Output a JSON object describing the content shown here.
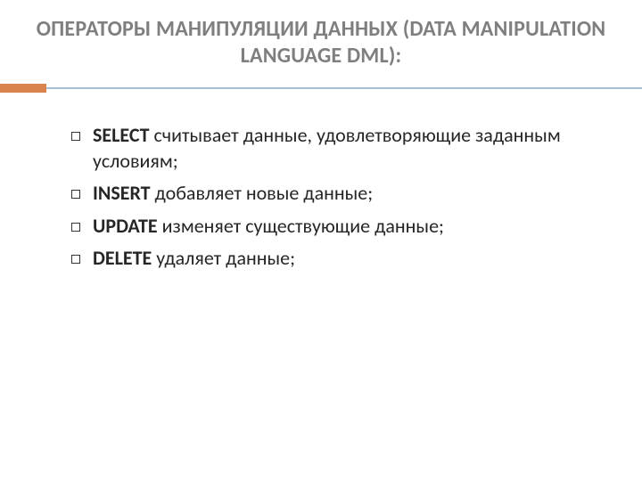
{
  "title": "ОПЕРАТОРЫ МАНИПУЛЯЦИИ ДАННЫХ (DATA MANIPULATION LANGUAGE DML):",
  "items": [
    {
      "keyword": "SELECT",
      "rest": " считывает данные, удовлетворяющие заданным условиям;"
    },
    {
      "keyword": "INSERT",
      "rest": "  добавляет новые данные;"
    },
    {
      "keyword": "UPDATE",
      "rest": " изменяет существующие данные;"
    },
    {
      "keyword": "DELETE",
      "rest": " удаляет данные;"
    }
  ]
}
